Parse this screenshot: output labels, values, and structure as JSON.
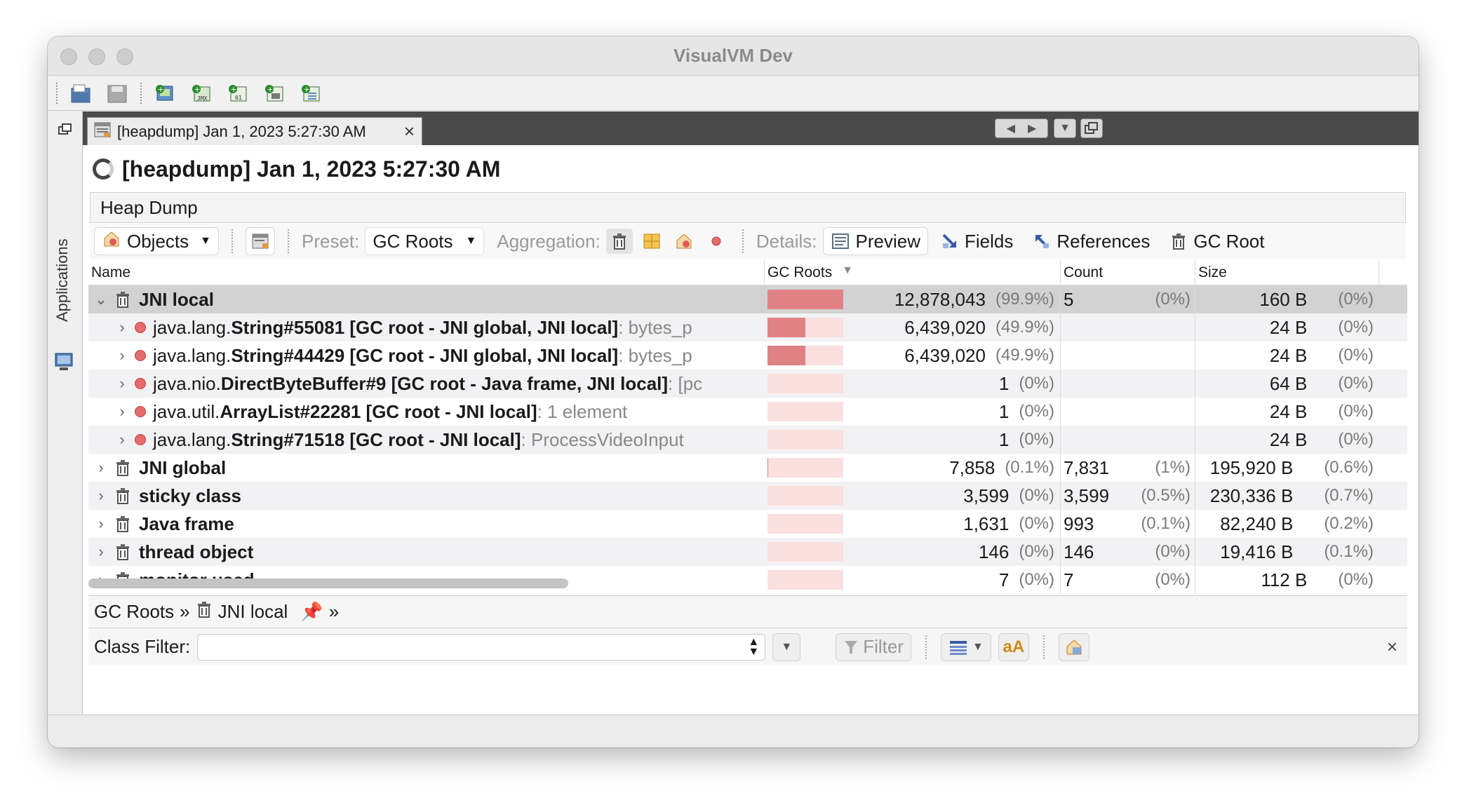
{
  "window": {
    "title": "VisualVM Dev"
  },
  "sidebar": {
    "applications_label": "Applications"
  },
  "tab": {
    "label": "[heapdump] Jan 1, 2023 5:27:30 AM",
    "close": "×"
  },
  "document": {
    "title": "[heapdump] Jan 1, 2023 5:27:30 AM"
  },
  "heap": {
    "header": "Heap Dump"
  },
  "controls": {
    "objects_label": "Objects",
    "preset_label": "Preset:",
    "preset_value": "GC Roots",
    "aggregation_label": "Aggregation:",
    "details_label": "Details:",
    "preview_label": "Preview",
    "fields_label": "Fields",
    "references_label": "References",
    "gcroot_label": "GC Root"
  },
  "table": {
    "headers": {
      "name": "Name",
      "gcroots": "GC Roots",
      "count": "Count",
      "size": "Size"
    },
    "rows": [
      {
        "expander": "⌄",
        "icon": "trash",
        "name_pre": "",
        "name_bold": "JNI local",
        "name_post": "",
        "hint": "",
        "bar_fraction": 0.999,
        "gc": "12,878,043",
        "gc_pct": "(99.9%)",
        "count": "5",
        "count_pct": "(0%)",
        "size": "160 B",
        "size_pct": "(0%)",
        "selected": true
      },
      {
        "expander": "›",
        "icon": "dot",
        "name_pre": "java.lang.",
        "name_bold": "String#55081 [GC root - JNI global, JNI local]",
        "name_post": "",
        "hint": " : bytes_p",
        "bar_fraction": 0.499,
        "gc": "6,439,020",
        "gc_pct": "(49.9%)",
        "count": "",
        "count_pct": "",
        "size": "24 B",
        "size_pct": "(0%)"
      },
      {
        "expander": "›",
        "icon": "dot",
        "name_pre": "java.lang.",
        "name_bold": "String#44429 [GC root - JNI global, JNI local]",
        "name_post": "",
        "hint": " : bytes_p",
        "bar_fraction": 0.499,
        "gc": "6,439,020",
        "gc_pct": "(49.9%)",
        "count": "",
        "count_pct": "",
        "size": "24 B",
        "size_pct": "(0%)"
      },
      {
        "expander": "›",
        "icon": "dot",
        "name_pre": "java.nio.",
        "name_bold": "DirectByteBuffer#9 [GC root - Java frame, JNI local]",
        "name_post": "",
        "hint": " : [pc",
        "bar_fraction": 0.0,
        "gc": "1",
        "gc_pct": "(0%)",
        "count": "",
        "count_pct": "",
        "size": "64 B",
        "size_pct": "(0%)"
      },
      {
        "expander": "›",
        "icon": "dot",
        "name_pre": "java.util.",
        "name_bold": "ArrayList#22281 [GC root - JNI local]",
        "name_post": "",
        "hint": " : 1 element",
        "bar_fraction": 0.0,
        "gc": "1",
        "gc_pct": "(0%)",
        "count": "",
        "count_pct": "",
        "size": "24 B",
        "size_pct": "(0%)"
      },
      {
        "expander": "›",
        "icon": "dot",
        "name_pre": "java.lang.",
        "name_bold": "String#71518 [GC root - JNI local]",
        "name_post": "",
        "hint": " : ProcessVideoInput",
        "bar_fraction": 0.0,
        "gc": "1",
        "gc_pct": "(0%)",
        "count": "",
        "count_pct": "",
        "size": "24 B",
        "size_pct": "(0%)"
      },
      {
        "expander": "›",
        "icon": "trash",
        "name_pre": "",
        "name_bold": "JNI global",
        "name_post": "",
        "hint": "",
        "bar_fraction": 0.001,
        "gc": "7,858",
        "gc_pct": "(0.1%)",
        "count": "7,831",
        "count_pct": "(1%)",
        "size": "195,920 B",
        "size_pct": "(0.6%)"
      },
      {
        "expander": "›",
        "icon": "trash",
        "name_pre": "",
        "name_bold": "sticky class",
        "name_post": "",
        "hint": "",
        "bar_fraction": 0.0,
        "gc": "3,599",
        "gc_pct": "(0%)",
        "count": "3,599",
        "count_pct": "(0.5%)",
        "size": "230,336 B",
        "size_pct": "(0.7%)"
      },
      {
        "expander": "›",
        "icon": "trash",
        "name_pre": "",
        "name_bold": "Java frame",
        "name_post": "",
        "hint": "",
        "bar_fraction": 0.0,
        "gc": "1,631",
        "gc_pct": "(0%)",
        "count": "993",
        "count_pct": "(0.1%)",
        "size": "82,240 B",
        "size_pct": "(0.2%)"
      },
      {
        "expander": "›",
        "icon": "trash",
        "name_pre": "",
        "name_bold": "thread object",
        "name_post": "",
        "hint": "",
        "bar_fraction": 0.0,
        "gc": "146",
        "gc_pct": "(0%)",
        "count": "146",
        "count_pct": "(0%)",
        "size": "19,416 B",
        "size_pct": "(0.1%)"
      },
      {
        "expander": "›",
        "icon": "trash",
        "name_pre": "",
        "name_bold": "monitor used",
        "name_post": "",
        "hint": "",
        "bar_fraction": 0.0,
        "gc": "7",
        "gc_pct": "(0%)",
        "count": "7",
        "count_pct": "(0%)",
        "size": "112 B",
        "size_pct": "(0%)"
      }
    ]
  },
  "breadcrumb": {
    "root": "GC Roots",
    "current": "JNI local"
  },
  "filter": {
    "label": "Class Filter:",
    "value": "",
    "button": "Filter"
  },
  "colors": {
    "bar_fill": "#e08285",
    "bar_bg": "#fbe0e0",
    "selected_row": "#d2d2d2",
    "tabbar": "#4a4a4a"
  }
}
